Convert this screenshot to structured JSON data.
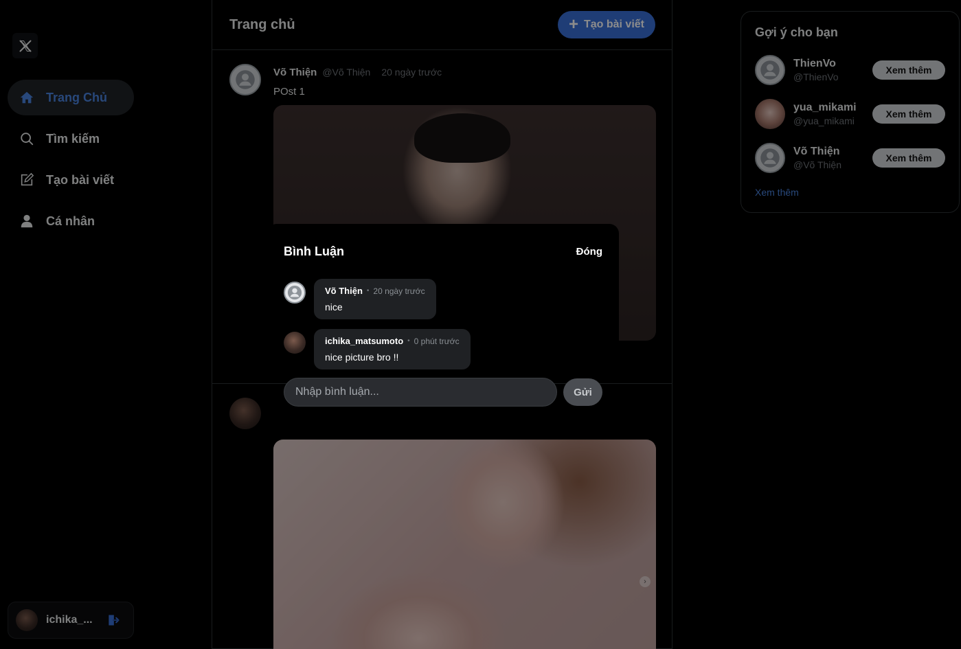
{
  "sidebar": {
    "logo": "x-logo-icon",
    "items": [
      {
        "label": "Trang Chủ",
        "icon": "home-icon",
        "active": true
      },
      {
        "label": "Tìm kiếm",
        "icon": "search-icon",
        "active": false
      },
      {
        "label": "Tạo bài viết",
        "icon": "edit-icon",
        "active": false
      },
      {
        "label": "Cá nhân",
        "icon": "user-icon",
        "active": false
      }
    ],
    "current_user": {
      "name": "ichika_...",
      "logout_icon": "logout-icon"
    }
  },
  "feed": {
    "title": "Trang chủ",
    "create_button": "Tạo bài viết",
    "posts": [
      {
        "author": "Võ Thiện",
        "handle": "@Võ Thiện",
        "time": "20 ngày trước",
        "text": "POst 1"
      },
      {
        "author": "",
        "handle": "",
        "time": "",
        "text": ""
      }
    ]
  },
  "suggestions": {
    "title": "Gợi ý cho bạn",
    "users": [
      {
        "name": "ThienVo",
        "handle": "@ThienVo",
        "button": "Xem thêm"
      },
      {
        "name": "yua_mikami",
        "handle": "@yua_mikami",
        "button": "Xem thêm"
      },
      {
        "name": "Võ Thiện",
        "handle": "@Võ Thiện",
        "button": "Xem thêm"
      }
    ],
    "see_more": "Xem thêm"
  },
  "comment_modal": {
    "title": "Bình Luận",
    "close_label": "Đóng",
    "comments": [
      {
        "author": "Võ Thiện",
        "time": "20 ngày trước",
        "text": "nice"
      },
      {
        "author": "ichika_matsumoto",
        "time": "0 phút trước",
        "text": "nice picture bro !!"
      }
    ],
    "input_placeholder": "Nhập bình luận...",
    "send_label": "Gửi"
  },
  "colors": {
    "accent": "#3a6fd8",
    "link": "#4a84e0",
    "background": "#000000"
  }
}
